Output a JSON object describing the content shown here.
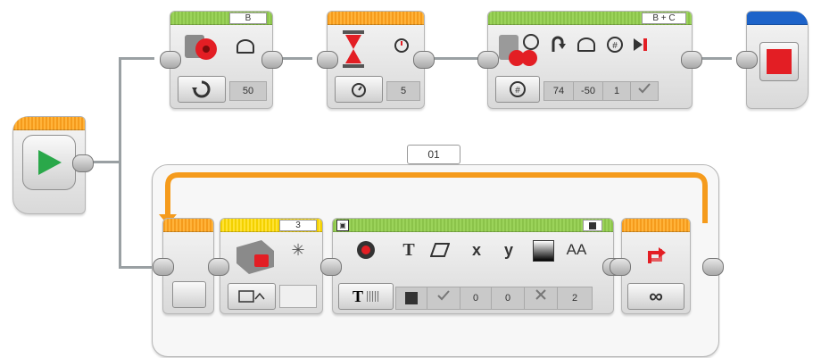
{
  "motor_block": {
    "port": "B",
    "value": "50"
  },
  "wait_block": {
    "value": "5"
  },
  "move_block": {
    "ports": "B + C",
    "steering": "74",
    "power": "-50",
    "rotations": "1"
  },
  "loop": {
    "label": "01"
  },
  "sensor_block": {
    "port": "3"
  },
  "display_block": {
    "x": "0",
    "y": "0",
    "font": "2",
    "text_icon": "T",
    "eraser_icon": "eraser",
    "x_label": "x",
    "y_label": "y",
    "font_label": "AA"
  },
  "loop_end": {
    "mode": "∞"
  },
  "colors": {
    "green": "#8bc34a",
    "orange": "#f59b1c",
    "yellow": "#f3d100",
    "blue": "#1d63c9",
    "stop_red": "#e31e24"
  }
}
